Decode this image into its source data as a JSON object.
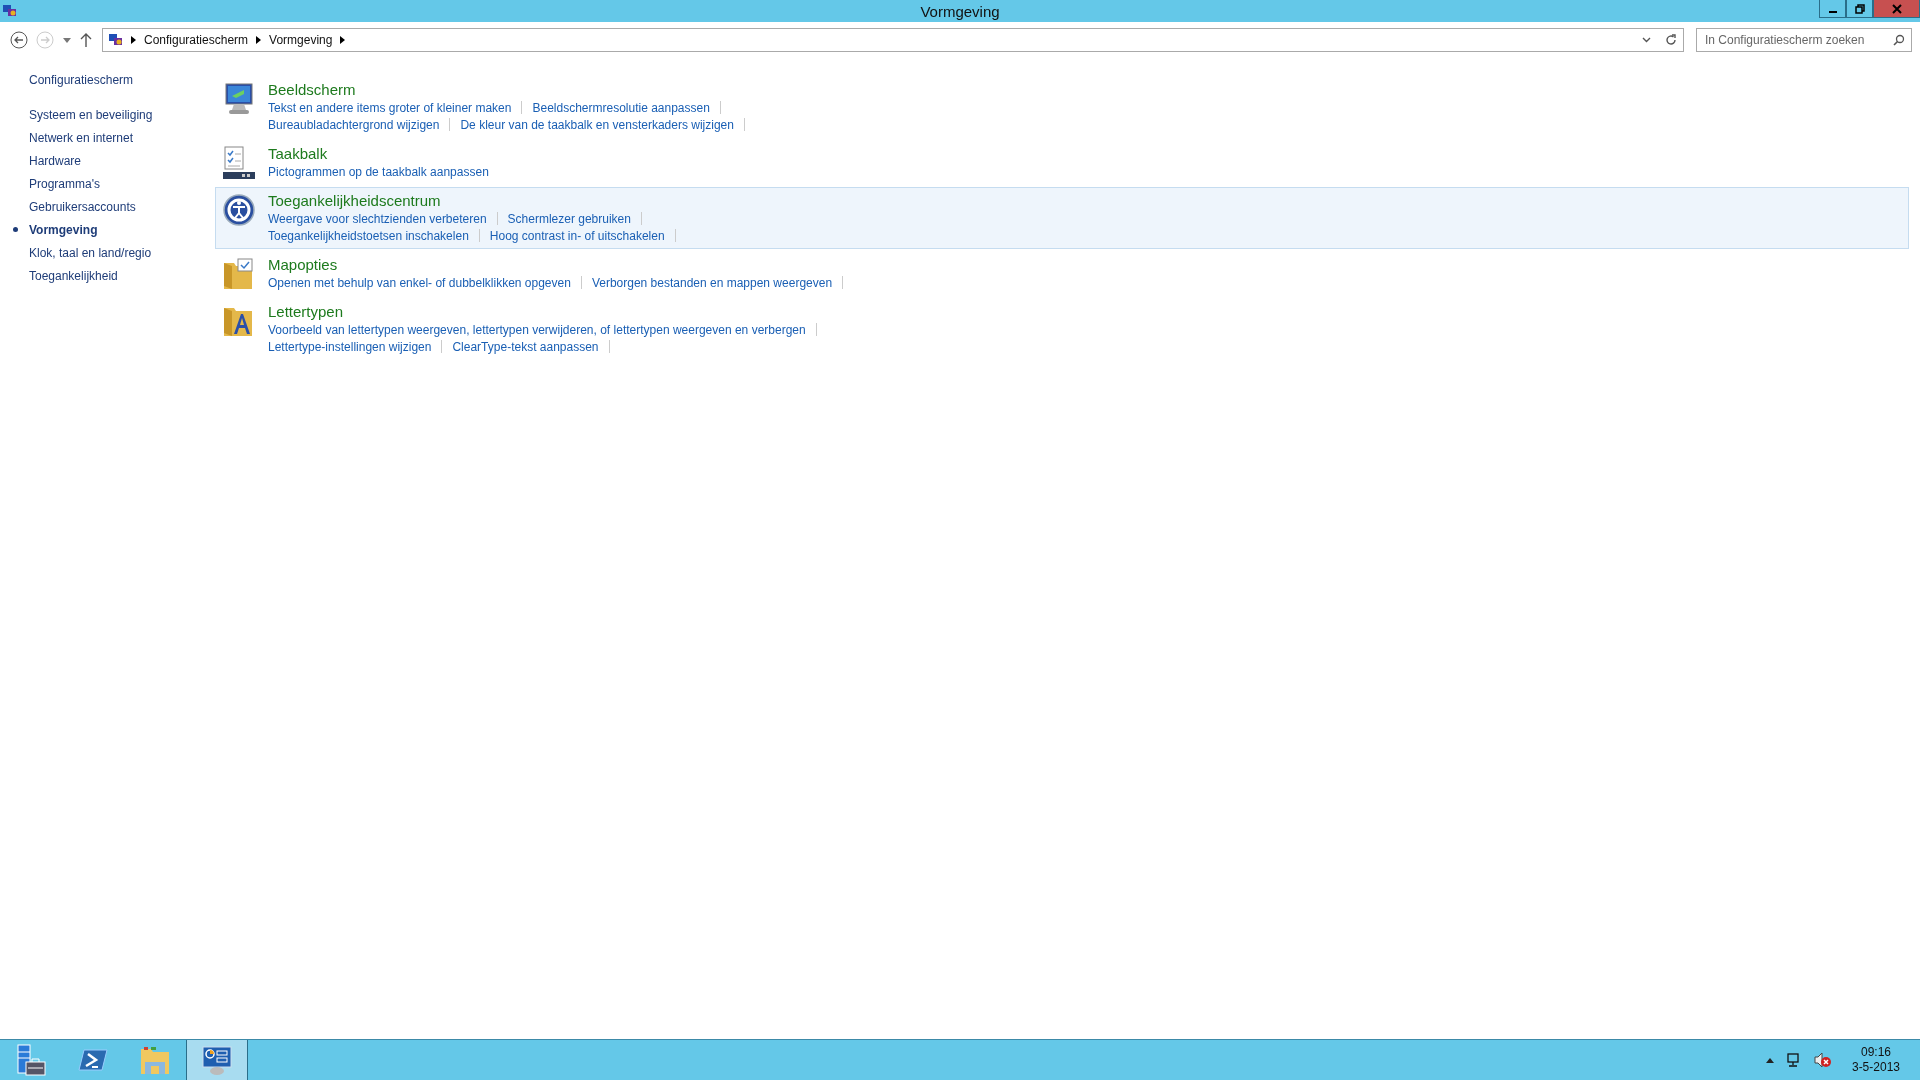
{
  "window": {
    "title": "Vormgeving"
  },
  "address_bar": {
    "breadcrumbs": [
      "Configuratiescherm",
      "Vormgeving"
    ]
  },
  "search": {
    "placeholder": "In Configuratiescherm zoeken"
  },
  "sidebar": {
    "home": "Configuratiescherm",
    "items": [
      {
        "label": "Systeem en beveiliging",
        "selected": false
      },
      {
        "label": "Netwerk en internet",
        "selected": false
      },
      {
        "label": "Hardware",
        "selected": false
      },
      {
        "label": "Programma's",
        "selected": false
      },
      {
        "label": "Gebruikersaccounts",
        "selected": false
      },
      {
        "label": "Vormgeving",
        "selected": true
      },
      {
        "label": "Klok, taal en land/regio",
        "selected": false
      },
      {
        "label": "Toegankelijkheid",
        "selected": false
      }
    ]
  },
  "categories": [
    {
      "kind": "display",
      "title": "Beeldscherm",
      "hovered": false,
      "link_rows": [
        [
          "Tekst en andere items groter of kleiner maken",
          "Beeldschermresolutie aanpassen"
        ],
        [
          "Bureaubladachtergrond wijzigen",
          "De kleur van de taakbalk en vensterkaders wijzigen"
        ]
      ]
    },
    {
      "kind": "taskbar",
      "title": "Taakbalk",
      "hovered": false,
      "link_rows": [
        [
          "Pictogrammen op de taakbalk aanpassen"
        ]
      ]
    },
    {
      "kind": "access",
      "title": "Toegankelijkheidscentrum",
      "hovered": true,
      "link_rows": [
        [
          "Weergave voor slechtzienden verbeteren",
          "Schermlezer gebruiken"
        ],
        [
          "Toegankelijkheidstoetsen inschakelen",
          "Hoog contrast in- of uitschakelen"
        ]
      ]
    },
    {
      "kind": "folder",
      "title": "Mapopties",
      "hovered": false,
      "link_rows": [
        [
          "Openen met behulp van enkel- of dubbelklikken opgeven",
          "Verborgen bestanden en mappen weergeven"
        ]
      ]
    },
    {
      "kind": "fonts",
      "title": "Lettertypen",
      "hovered": false,
      "link_rows": [
        [
          "Voorbeeld van lettertypen weergeven, lettertypen verwijderen, of lettertypen weergeven en verbergen"
        ],
        [
          "Lettertype-instellingen wijzigen",
          "ClearType-tekst aanpassen"
        ]
      ]
    }
  ],
  "taskbar": {
    "apps": [
      {
        "kind": "server",
        "selected": false
      },
      {
        "kind": "shell",
        "selected": false
      },
      {
        "kind": "explorer",
        "selected": false
      },
      {
        "kind": "control",
        "selected": true
      }
    ],
    "clock": {
      "time": "09:16",
      "date": "3-5-2013"
    }
  }
}
